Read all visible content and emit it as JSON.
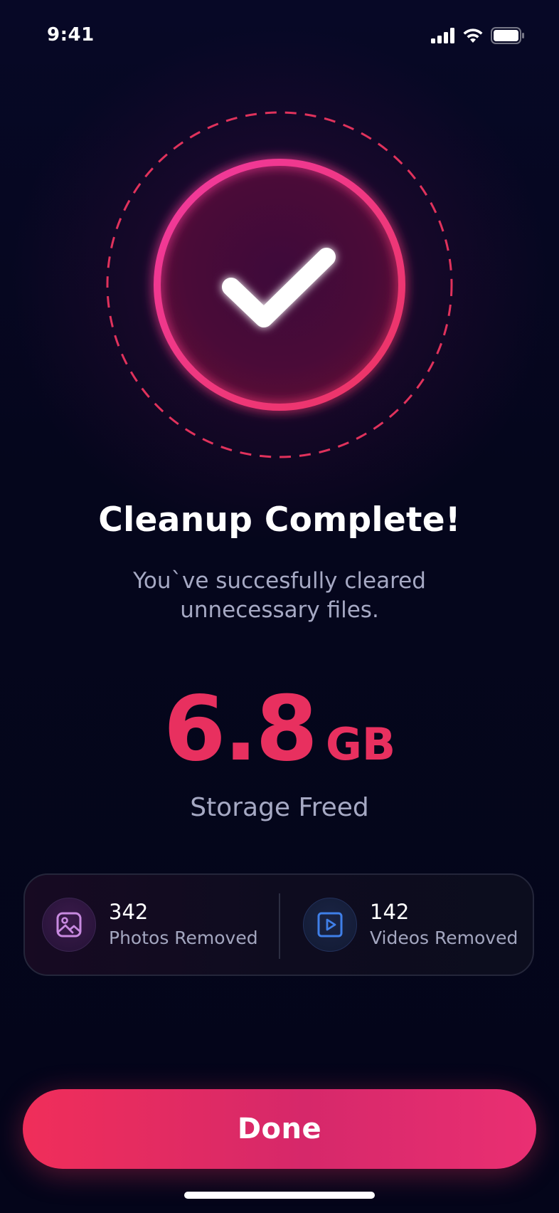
{
  "status_bar": {
    "time": "9:41",
    "icons": [
      "cellular-signal-icon",
      "wifi-icon",
      "battery-icon"
    ]
  },
  "hero": {
    "icon": "checkmark-icon",
    "colors": {
      "ring": "#f0348a",
      "dashed_ring": "#e0325c",
      "checkmark": "#ffffff"
    }
  },
  "title": "Cleanup Complete!",
  "subtitle_lines": [
    "You`ve succesfully cleared",
    "unnecessary files."
  ],
  "storage": {
    "value": "6.8",
    "unit": "GB",
    "label": "Storage Freed",
    "color": "#e8305f"
  },
  "stats": {
    "photos": {
      "count": "342",
      "label": "Photos Removed",
      "icon": "image-icon",
      "icon_color": "#c88ae0"
    },
    "videos": {
      "count": "142",
      "label": "Videos Removed",
      "icon": "video-play-icon",
      "icon_color": "#3f7fe8"
    }
  },
  "done_button": {
    "label": "Done",
    "color": "#f02e5a"
  }
}
